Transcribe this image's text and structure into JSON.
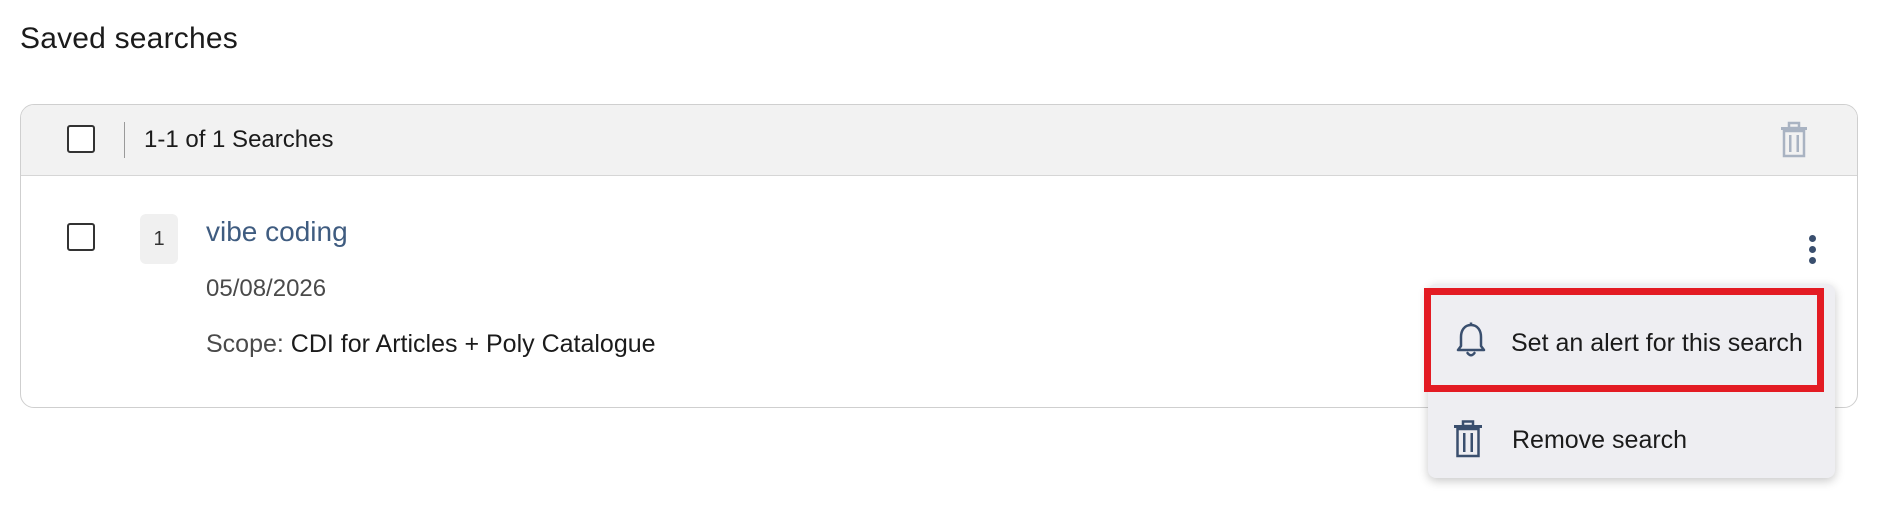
{
  "page": {
    "title": "Saved searches"
  },
  "list_header": {
    "count_label": "1-1 of 1 Searches",
    "delete_icon": "trash-icon"
  },
  "saved_searches": [
    {
      "index": "1",
      "title": "vibe coding",
      "date": "05/08/2026",
      "scope_label": "Scope:",
      "scope_value": "CDI for Articles + Poly Catalogue",
      "menu_icon": "kebab-menu-icon"
    }
  ],
  "row_menu": {
    "items": [
      {
        "label": "Set an alert for this search",
        "icon": "bell-icon",
        "highlighted": true
      },
      {
        "label": "Remove search",
        "icon": "trash-icon",
        "highlighted": false
      }
    ]
  },
  "colors": {
    "link": "#3f5c80",
    "highlight_border": "#e31b23",
    "icon": "#3a4f6e",
    "header_bg": "#f2f2f2",
    "menu_bg": "#eeeef2"
  }
}
